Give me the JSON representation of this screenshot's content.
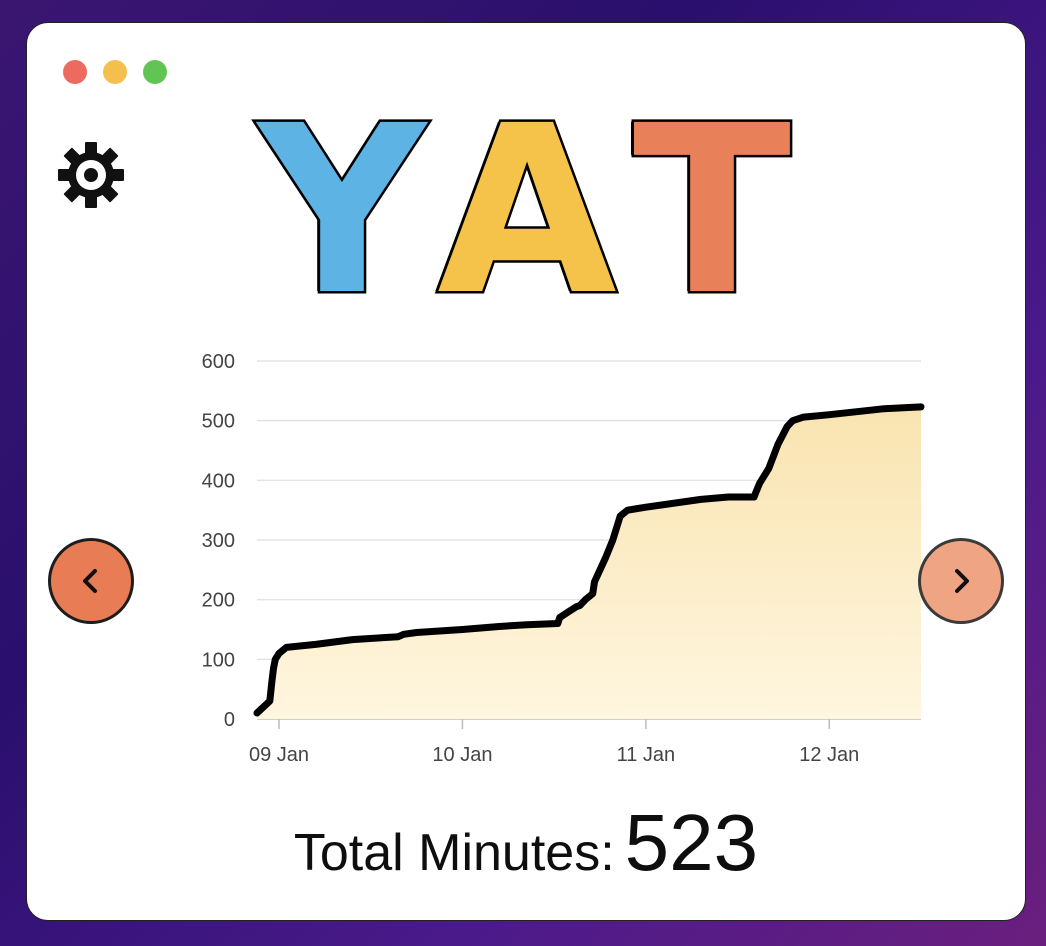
{
  "app": {
    "logo_letters": [
      {
        "char": "Y",
        "color": "#5db3e4"
      },
      {
        "char": "A",
        "color": "#f5c24a"
      },
      {
        "char": "T",
        "color": "#e8805a"
      }
    ]
  },
  "icons": {
    "settings": "gear-icon",
    "prev": "chevron-left-icon",
    "next": "chevron-right-icon"
  },
  "colors": {
    "line": "#000000",
    "area_top": "#f9e4b0",
    "area_bottom": "#fff6e0",
    "prev_button": "#e87c55",
    "next_button": "#efa584"
  },
  "summary": {
    "label": "Total Minutes:",
    "value": "523"
  },
  "chart_data": {
    "type": "area",
    "title": "",
    "xlabel": "",
    "ylabel": "",
    "ylim": [
      0,
      600
    ],
    "yticks": [
      0,
      100,
      200,
      300,
      400,
      500,
      600
    ],
    "xlim": [
      8.88,
      12.5
    ],
    "xticks": [
      {
        "value": 9,
        "label": "09 Jan"
      },
      {
        "value": 10,
        "label": "10 Jan"
      },
      {
        "value": 11,
        "label": "11 Jan"
      },
      {
        "value": 12,
        "label": "12 Jan"
      }
    ],
    "grid": true,
    "legend": "none",
    "series": [
      {
        "x": [
          8.88,
          8.95,
          8.96,
          8.97,
          8.98,
          9.0,
          9.04,
          9.2,
          9.4,
          9.65,
          9.68,
          9.75,
          10.0,
          10.2,
          10.35,
          10.52,
          10.53,
          10.58,
          10.62,
          10.64,
          10.67,
          10.71,
          10.72,
          10.78,
          10.82,
          10.86,
          10.9,
          11.0,
          11.3,
          11.45,
          11.59,
          11.6,
          11.62,
          11.67,
          11.72,
          11.77,
          11.8,
          11.86,
          12.0,
          12.3,
          12.5
        ],
        "y": [
          10,
          30,
          60,
          85,
          100,
          110,
          120,
          125,
          133,
          138,
          142,
          145,
          150,
          155,
          158,
          160,
          170,
          180,
          188,
          190,
          200,
          210,
          230,
          270,
          300,
          340,
          350,
          355,
          368,
          372,
          372,
          380,
          395,
          420,
          460,
          490,
          500,
          506,
          510,
          520,
          523
        ]
      }
    ]
  }
}
